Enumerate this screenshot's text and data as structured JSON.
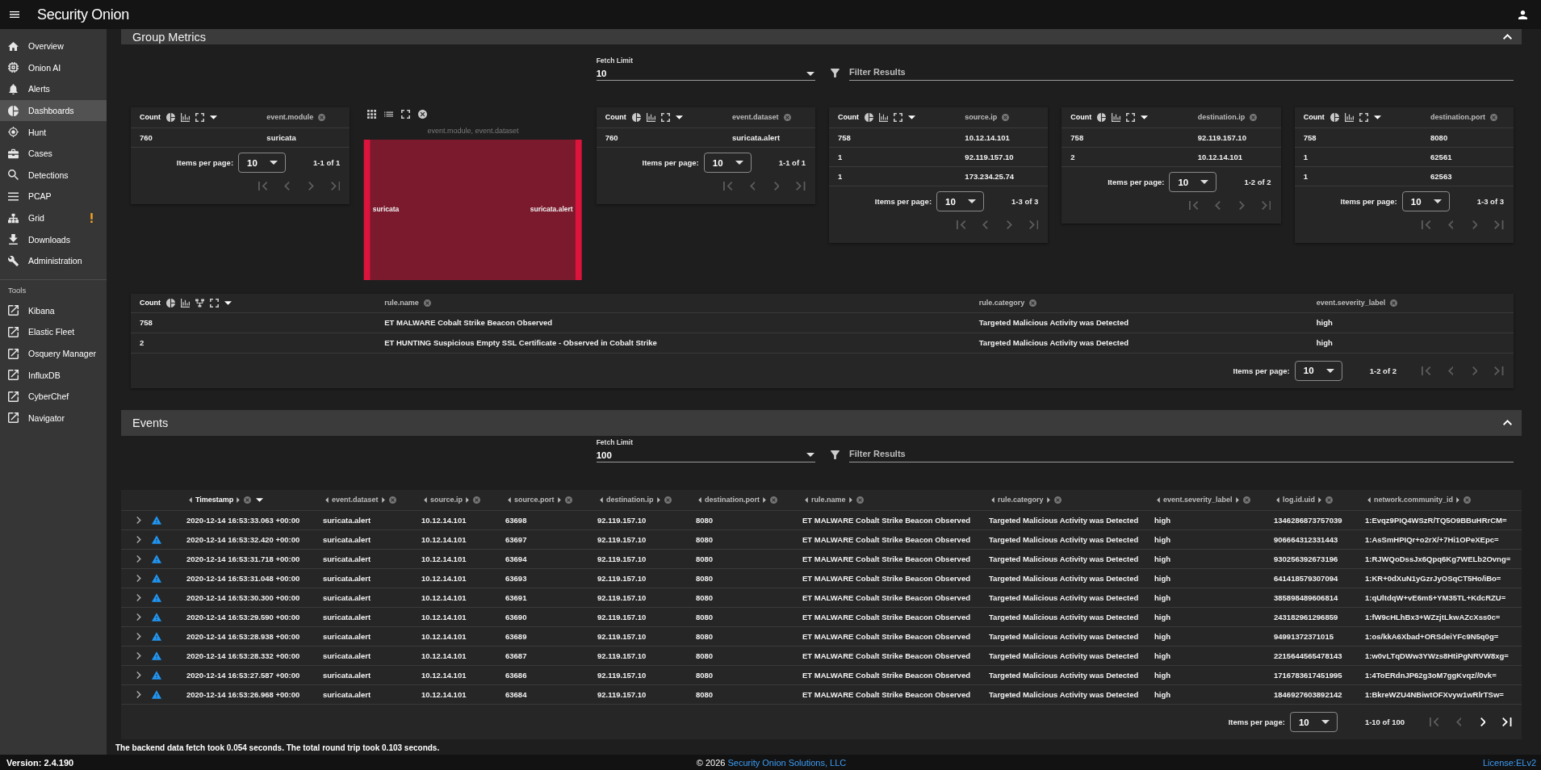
{
  "app_bar": {
    "title": "Security Onion"
  },
  "sidebar": {
    "items": [
      {
        "label": "Overview",
        "selected": false,
        "warning": false
      },
      {
        "label": "Onion AI",
        "selected": false,
        "warning": false
      },
      {
        "label": "Alerts",
        "selected": false,
        "warning": false
      },
      {
        "label": "Dashboards",
        "selected": true,
        "warning": false
      },
      {
        "label": "Hunt",
        "selected": false,
        "warning": false
      },
      {
        "label": "Cases",
        "selected": false,
        "warning": false
      },
      {
        "label": "Detections",
        "selected": false,
        "warning": false
      },
      {
        "label": "PCAP",
        "selected": false,
        "warning": false
      },
      {
        "label": "Grid",
        "selected": false,
        "warning": true
      },
      {
        "label": "Downloads",
        "selected": false,
        "warning": false
      },
      {
        "label": "Administration",
        "selected": false,
        "warning": false
      }
    ],
    "tools_heading": "Tools",
    "tools": [
      {
        "label": "Kibana"
      },
      {
        "label": "Elastic Fleet"
      },
      {
        "label": "Osquery Manager"
      },
      {
        "label": "InfluxDB"
      },
      {
        "label": "CyberChef"
      },
      {
        "label": "Navigator"
      }
    ]
  },
  "group_metrics": {
    "title": "Group Metrics",
    "expanded": true,
    "fetch_limit": {
      "label": "Fetch Limit",
      "value": "10"
    },
    "filter": {
      "placeholder": "Filter Results"
    },
    "panels": [
      {
        "kind": "table",
        "columns": [
          "Count",
          "event.module"
        ],
        "rows": [
          [
            "760",
            "suricata"
          ]
        ],
        "pager": {
          "label": "Items per page:",
          "value": "10",
          "range": "1-1 of 1",
          "buttons": [
            {
              "disabled": true
            },
            {
              "disabled": true
            },
            {
              "disabled": true
            },
            {
              "disabled": true
            }
          ]
        }
      },
      {
        "kind": "sankey",
        "title": "event.module, event.dataset",
        "nodes": [
          "suricata",
          "suricata.alert"
        ]
      },
      {
        "kind": "table",
        "columns": [
          "Count",
          "event.dataset"
        ],
        "rows": [
          [
            "760",
            "suricata.alert"
          ]
        ],
        "pager": {
          "label": "Items per page:",
          "value": "10",
          "range": "1-1 of 1",
          "buttons": [
            {
              "disabled": true
            },
            {
              "disabled": true
            },
            {
              "disabled": true
            },
            {
              "disabled": true
            }
          ]
        }
      },
      {
        "kind": "table",
        "columns": [
          "Count",
          "source.ip"
        ],
        "rows": [
          [
            "758",
            "10.12.14.101"
          ],
          [
            "1",
            "92.119.157.10"
          ],
          [
            "1",
            "173.234.25.74"
          ]
        ],
        "pager": {
          "label": "Items per page:",
          "value": "10",
          "range": "1-3 of 3",
          "buttons": [
            {
              "disabled": true
            },
            {
              "disabled": true
            },
            {
              "disabled": true
            },
            {
              "disabled": true
            }
          ]
        }
      },
      {
        "kind": "table",
        "columns": [
          "Count",
          "destination.ip"
        ],
        "rows": [
          [
            "758",
            "92.119.157.10"
          ],
          [
            "2",
            "10.12.14.101"
          ]
        ],
        "pager": {
          "label": "Items per page:",
          "value": "10",
          "range": "1-2 of 2",
          "buttons": [
            {
              "disabled": true
            },
            {
              "disabled": true
            },
            {
              "disabled": true
            },
            {
              "disabled": true
            }
          ]
        }
      },
      {
        "kind": "table",
        "columns": [
          "Count",
          "destination.port"
        ],
        "rows": [
          [
            "758",
            "8080"
          ],
          [
            "1",
            "62561"
          ],
          [
            "1",
            "62563"
          ]
        ],
        "pager": {
          "label": "Items per page:",
          "value": "10",
          "range": "1-3 of 3",
          "buttons": [
            {
              "disabled": true
            },
            {
              "disabled": true
            },
            {
              "disabled": true
            },
            {
              "disabled": true
            }
          ]
        }
      },
      {
        "kind": "table",
        "columns": [
          "Count",
          "rule.name",
          "rule.category",
          "event.severity_label"
        ],
        "rows": [
          [
            "758",
            "ET MALWARE Cobalt Strike Beacon Observed",
            "Targeted Malicious Activity was Detected",
            "high"
          ],
          [
            "2",
            "ET HUNTING Suspicious Empty SSL Certificate - Observed in Cobalt Strike",
            "Targeted Malicious Activity was Detected",
            "high"
          ]
        ],
        "pager": {
          "label": "Items per page:",
          "value": "10",
          "range": "1-2 of 2",
          "buttons": [
            {
              "disabled": true
            },
            {
              "disabled": true
            },
            {
              "disabled": true
            },
            {
              "disabled": true
            }
          ]
        }
      }
    ]
  },
  "events": {
    "title": "Events",
    "expanded": true,
    "fetch_limit": {
      "label": "Fetch Limit",
      "value": "100"
    },
    "filter": {
      "placeholder": "Filter Results"
    },
    "table": {
      "columns": [
        {
          "label": "Timestamp",
          "sorted": true
        },
        {
          "label": "event.dataset",
          "sorted": false
        },
        {
          "label": "source.ip",
          "sorted": false
        },
        {
          "label": "source.port",
          "sorted": false
        },
        {
          "label": "destination.ip",
          "sorted": false
        },
        {
          "label": "destination.port",
          "sorted": false
        },
        {
          "label": "rule.name",
          "sorted": false
        },
        {
          "label": "rule.category",
          "sorted": false
        },
        {
          "label": "event.severity_label",
          "sorted": false
        },
        {
          "label": "log.id.uid",
          "sorted": false
        },
        {
          "label": "network.community_id",
          "sorted": false
        }
      ],
      "rows": [
        [
          "2020-12-14 16:53:33.063 +00:00",
          "suricata.alert",
          "10.12.14.101",
          "63698",
          "92.119.157.10",
          "8080",
          "ET MALWARE Cobalt Strike Beacon Observed",
          "Targeted Malicious Activity was Detected",
          "high",
          "1346286873757039",
          "1:Evqz9PIQ4WSzR/TQ5O9BBuHRrCM="
        ],
        [
          "2020-12-14 16:53:32.420 +00:00",
          "suricata.alert",
          "10.12.14.101",
          "63697",
          "92.119.157.10",
          "8080",
          "ET MALWARE Cobalt Strike Beacon Observed",
          "Targeted Malicious Activity was Detected",
          "high",
          "906664312331443",
          "1:AsSmHPIQr+o2rX/+7Hi1OPeXEpc="
        ],
        [
          "2020-12-14 16:53:31.718 +00:00",
          "suricata.alert",
          "10.12.14.101",
          "63694",
          "92.119.157.10",
          "8080",
          "ET MALWARE Cobalt Strike Beacon Observed",
          "Targeted Malicious Activity was Detected",
          "high",
          "930256392673196",
          "1:RJWQoDssJx6Qpq6Kg7WELb2Ovng="
        ],
        [
          "2020-12-14 16:53:31.048 +00:00",
          "suricata.alert",
          "10.12.14.101",
          "63693",
          "92.119.157.10",
          "8080",
          "ET MALWARE Cobalt Strike Beacon Observed",
          "Targeted Malicious Activity was Detected",
          "high",
          "641418579307094",
          "1:KR+0dXuN1yGzrJyOSqCT5Ho/iBo="
        ],
        [
          "2020-12-14 16:53:30.300 +00:00",
          "suricata.alert",
          "10.12.14.101",
          "63691",
          "92.119.157.10",
          "8080",
          "ET MALWARE Cobalt Strike Beacon Observed",
          "Targeted Malicious Activity was Detected",
          "high",
          "385898489606814",
          "1:qUltdqW+vE6m5+YM35TL+KdcRZU="
        ],
        [
          "2020-12-14 16:53:29.590 +00:00",
          "suricata.alert",
          "10.12.14.101",
          "63690",
          "92.119.157.10",
          "8080",
          "ET MALWARE Cobalt Strike Beacon Observed",
          "Targeted Malicious Activity was Detected",
          "high",
          "243182961296859",
          "1:fW9cHLhBx3+WZzjtLkwAZcXss0c="
        ],
        [
          "2020-12-14 16:53:28.938 +00:00",
          "suricata.alert",
          "10.12.14.101",
          "63689",
          "92.119.157.10",
          "8080",
          "ET MALWARE Cobalt Strike Beacon Observed",
          "Targeted Malicious Activity was Detected",
          "high",
          "94991372371015",
          "1:os/kkA6Xbad+ORSdeiYFc9N5q0g="
        ],
        [
          "2020-12-14 16:53:28.332 +00:00",
          "suricata.alert",
          "10.12.14.101",
          "63687",
          "92.119.157.10",
          "8080",
          "ET MALWARE Cobalt Strike Beacon Observed",
          "Targeted Malicious Activity was Detected",
          "high",
          "2215644565478143",
          "1:w0vLTqDWw3YWzs8HtiPgNRVW8xg="
        ],
        [
          "2020-12-14 16:53:27.587 +00:00",
          "suricata.alert",
          "10.12.14.101",
          "63686",
          "92.119.157.10",
          "8080",
          "ET MALWARE Cobalt Strike Beacon Observed",
          "Targeted Malicious Activity was Detected",
          "high",
          "1716783617451995",
          "1:4ToERdnJP62g3oM7ggKvqz//0vk="
        ],
        [
          "2020-12-14 16:53:26.968 +00:00",
          "suricata.alert",
          "10.12.14.101",
          "63684",
          "92.119.157.10",
          "8080",
          "ET MALWARE Cobalt Strike Beacon Observed",
          "Targeted Malicious Activity was Detected",
          "high",
          "1846927603892142",
          "1:BkreWZU4NBiwtOFXvyw1wRlrTSw="
        ]
      ],
      "pager": {
        "label": "Items per page:",
        "value": "10",
        "range": "1-10 of 100",
        "buttons": [
          {
            "disabled": true
          },
          {
            "disabled": true
          },
          {
            "disabled": false
          },
          {
            "disabled": false
          }
        ]
      }
    },
    "timing": "The backend data fetch took 0.054 seconds. The total round trip took 0.103 seconds."
  },
  "footer": {
    "version": "Version: 2.4.190",
    "copyright": "© 2026",
    "company": "Security Onion Solutions, LLC",
    "license": "License:ELv2"
  }
}
